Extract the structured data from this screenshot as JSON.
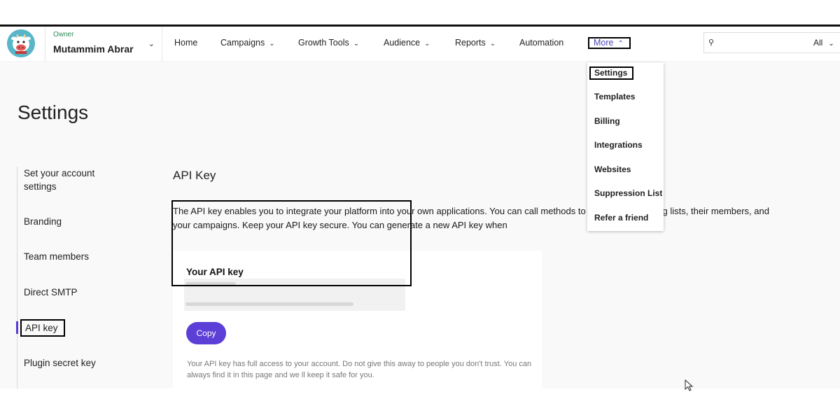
{
  "account": {
    "role": "Owner",
    "name": "Mutammim Abrar"
  },
  "nav": {
    "home": "Home",
    "campaigns": "Campaigns",
    "growth_tools": "Growth Tools",
    "audience": "Audience",
    "reports": "Reports",
    "automation": "Automation",
    "more": "More"
  },
  "search": {
    "placeholder": "",
    "scope": "All"
  },
  "page": {
    "title": "Settings"
  },
  "sidebar": {
    "items": [
      {
        "label": "Set your account settings"
      },
      {
        "label": "Branding"
      },
      {
        "label": "Team members"
      },
      {
        "label": "Direct SMTP"
      },
      {
        "label": "API key"
      },
      {
        "label": "Plugin secret key"
      }
    ]
  },
  "api": {
    "section_title": "API Key",
    "description": "The API key enables you to integrate your platform into your own applications. You can call methods to update your mailing lists, their members, and your campaigns. Keep your API key secure. You can generate a new API key when",
    "card_label": "Your API key",
    "copy_label": "Copy",
    "note": "Your API key has full access to your account. Do not give this away to people you don't trust. You can always find it in this page and we ll keep it safe for you."
  },
  "more_menu": {
    "items": [
      "Settings",
      "Templates",
      "Billing",
      "Integrations",
      "Websites",
      "Suppression List",
      "Refer a friend"
    ]
  },
  "colors": {
    "accent": "#5b3fd6",
    "role": "#2e8b57",
    "more_link": "#4a47b8"
  },
  "icons": {
    "logo": "cow-mascot-logo",
    "search": "search-icon",
    "chevron": "chevron-down-icon"
  }
}
